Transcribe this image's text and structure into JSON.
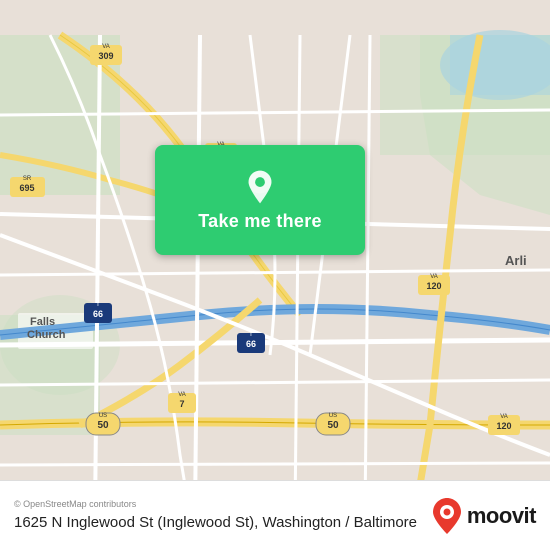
{
  "map": {
    "attribution": "© OpenStreetMap contributors",
    "address": "1625 N Inglewood St (Inglewood St), Washington / Baltimore",
    "button_label": "Take me there",
    "center_lat": 38.876,
    "center_lng": -77.13,
    "bg_color": "#e8e0d8"
  },
  "branding": {
    "moovit_label": "moovit"
  },
  "colors": {
    "button_green": "#2ecc71",
    "road_yellow": "#f5d76e",
    "road_white": "#ffffff",
    "highway_blue": "#6fa8dc",
    "interstate_blue": "#3366cc",
    "map_bg": "#e8e0d8",
    "green_area": "#c8dfc0",
    "water": "#aad3df"
  }
}
